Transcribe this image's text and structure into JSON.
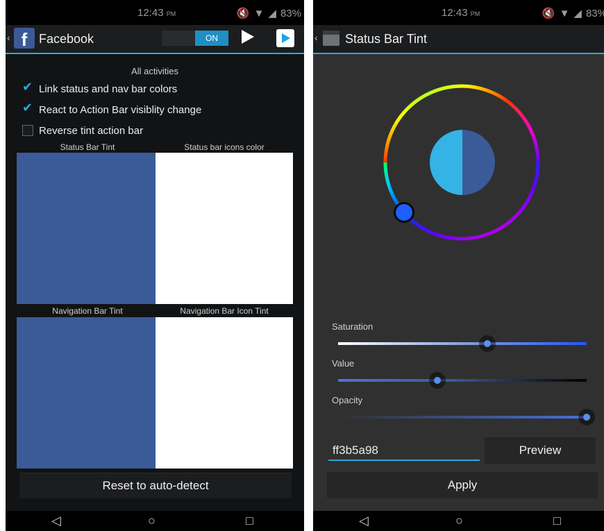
{
  "left_screen": {
    "status_bar": {
      "time": "12:43",
      "time_suffix": "PM",
      "battery": "83%"
    },
    "action_bar": {
      "app_title": "Facebook",
      "toggle_label": "ON"
    },
    "section_title": "All activities",
    "checkboxes": [
      {
        "label": "Link status and nav bar colors",
        "checked": true
      },
      {
        "label": "React to Action Bar visiblity change",
        "checked": true
      },
      {
        "label": "Reverse tint action bar",
        "checked": false
      }
    ],
    "swatch_headers": {
      "status_bar_tint": "Status Bar Tint",
      "status_bar_icons_color": "Status bar icons color",
      "navigation_bar_tint": "Navigation Bar Tint",
      "navigation_bar_icon_tint": "Navigation Bar Icon Tint"
    },
    "colors": {
      "tint_blue": "#3b5a98",
      "icon_white": "#ffffff"
    },
    "reset_button": "Reset to auto-detect"
  },
  "right_screen": {
    "status_bar": {
      "time": "12:43",
      "time_suffix": "PM",
      "battery": "83%"
    },
    "action_bar": {
      "title": "Status Bar Tint"
    },
    "color_preview": {
      "old_color": "#35b3e4",
      "new_color": "#3b5a98"
    },
    "sliders": [
      {
        "label": "Saturation",
        "value": 0.6
      },
      {
        "label": "Value",
        "value": 0.4
      },
      {
        "label": "Opacity",
        "value": 1.0
      }
    ],
    "hex_value": "ff3b5a98",
    "preview_button": "Preview",
    "apply_button": "Apply"
  },
  "nav_icons": [
    "back-icon",
    "home-icon",
    "recents-icon"
  ]
}
